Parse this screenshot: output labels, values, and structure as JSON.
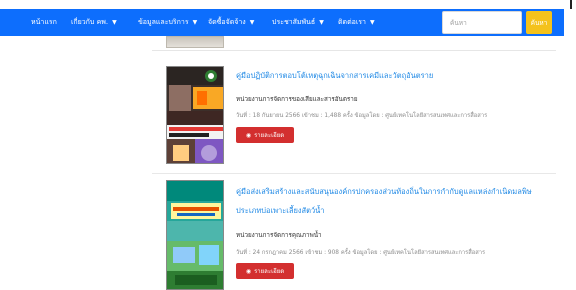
{
  "nav": {
    "items": [
      {
        "label": "หน้าแรก",
        "caret": false
      },
      {
        "label": "เกี่ยวกับ คพ.",
        "caret": true
      },
      {
        "label": "ข้อมูลและบริการ",
        "caret": true
      },
      {
        "label": "จัดซื้อจัดจ้าง",
        "caret": true
      },
      {
        "label": "ประชาสัมพันธ์",
        "caret": true
      },
      {
        "label": "ติดต่อเรา",
        "caret": true
      }
    ],
    "caret_glyph": "▼"
  },
  "search": {
    "placeholder": "ค้นหา",
    "button_label": "ค้นหา"
  },
  "books": [
    {
      "title": "คู่มือปฏิบัติการตอบโต้เหตุฉุกเฉินจากสารเคมีและวัตถุอันตราย",
      "agency": "หน่วยงานการจัดการของเสียและสารอันตราย",
      "meta": "วันที่ : 18 กันยายน 2566   เข้าชม : 1,488 ครั้ง   ข้อมูลโดย : ศูนย์เทคโนโลยีสารสนเทศและการสื่อสาร",
      "button_label": "รายละเอียด"
    },
    {
      "title": "คู่มือส่งเสริมสร้างและสนับสนุนองค์กรปกครองส่วนท้องถิ่นในการกำกับดูแลแหล่งกำเนิดมลพิษประเภทบ่อเพาะเลี้ยงสัตว์น้ำ",
      "agency": "หน่วยงานการจัดการคุณภาพน้ำ",
      "meta": "วันที่ : 24 กรกฎาคม 2566   เข้าชม : 908 ครั้ง   ข้อมูลโดย : ศูนย์เทคโนโลยีสารสนเทศและการสื่อสาร",
      "button_label": "รายละเอียด"
    }
  ],
  "colors": {
    "navbar": "#0d6efd",
    "search_button": "#f4c21c",
    "detail_button": "#d32f2f",
    "title_link": "#1e88e5"
  },
  "icons": {
    "eye": "eye-icon",
    "caret": "caret-down-icon"
  }
}
